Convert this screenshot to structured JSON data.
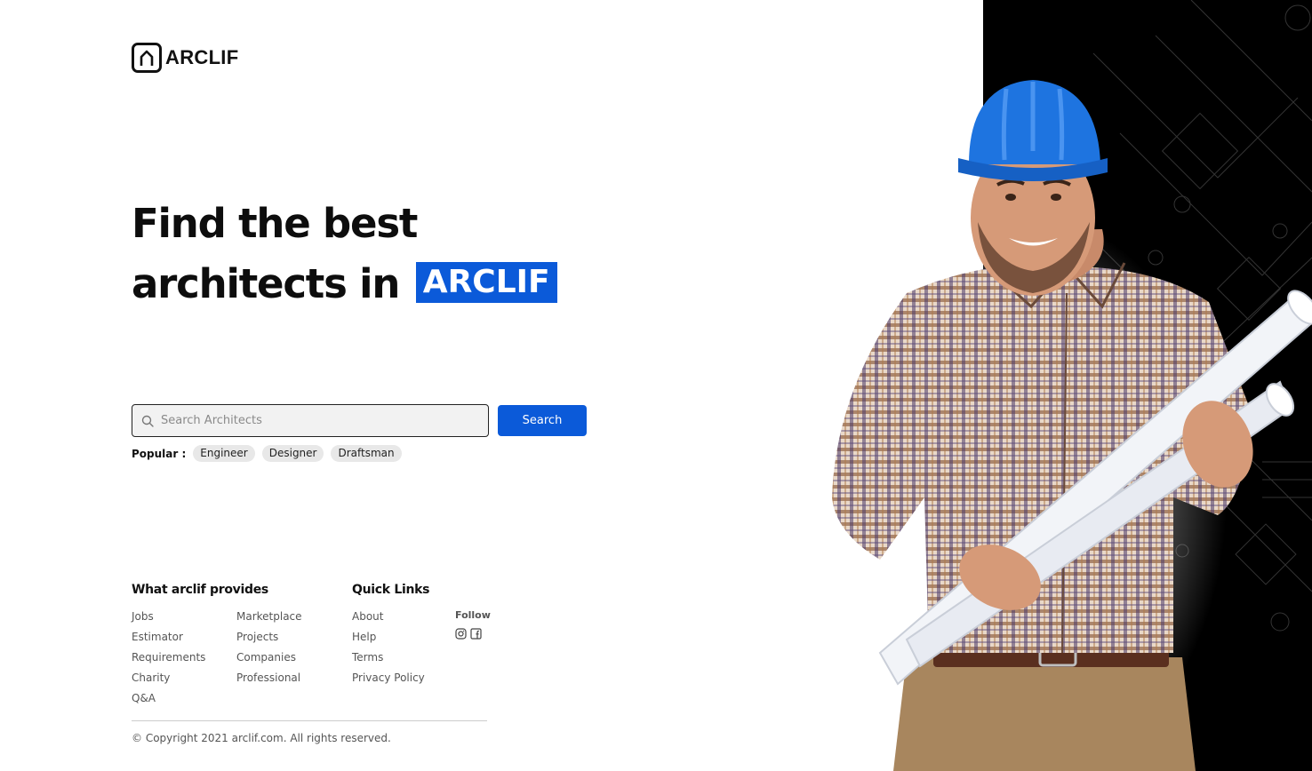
{
  "brand": {
    "name": "ARCLIF"
  },
  "hero": {
    "line1": "Find the best",
    "line2": "architects in",
    "highlight": "ARCLIF"
  },
  "search": {
    "placeholder": "Search Architects",
    "button_label": "Search"
  },
  "popular": {
    "label": "Popular :",
    "tags": [
      "Engineer",
      "Designer",
      "Draftsman"
    ]
  },
  "footer": {
    "provides": {
      "heading": "What arclif provides",
      "col1": [
        "Jobs",
        "Estimator",
        "Requirements",
        "Charity",
        "Q&A"
      ],
      "col2": [
        "Marketplace",
        "Projects",
        "Companies",
        "Professional"
      ]
    },
    "quick_links": {
      "heading": "Quick Links",
      "items": [
        "About",
        "Help",
        "Terms",
        "Privacy Policy"
      ]
    },
    "follow": {
      "label": "Follow",
      "icons": [
        "instagram-icon",
        "facebook-icon"
      ]
    },
    "copyright": "© Copyright 2021 arclif.com. All rights reserved."
  },
  "colors": {
    "accent": "#0b5ad9",
    "hero_dark": "#000000"
  }
}
